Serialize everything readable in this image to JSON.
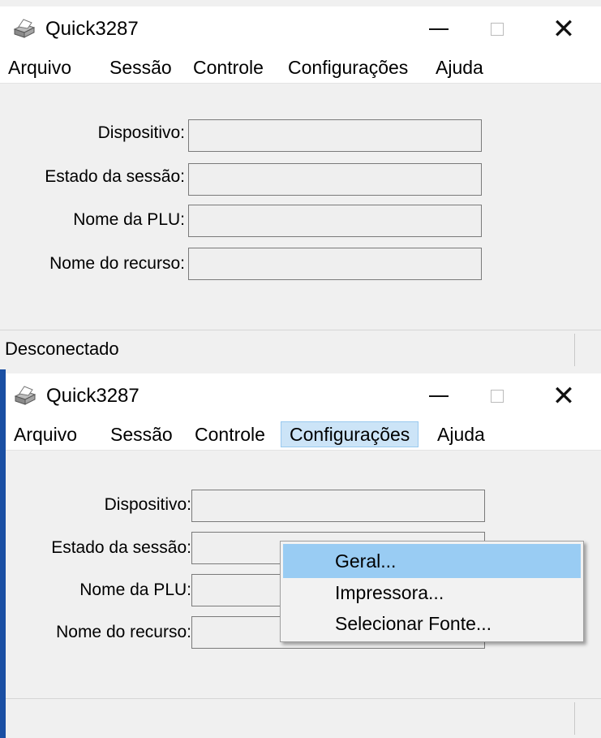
{
  "window1": {
    "title": "Quick3287",
    "menu": [
      "Arquivo",
      "Sessão",
      "Controle",
      "Configurações",
      "Ajuda"
    ],
    "fields": [
      {
        "label": "Dispositivo:",
        "value": ""
      },
      {
        "label": "Estado da sessão:",
        "value": ""
      },
      {
        "label": "Nome da PLU:",
        "value": ""
      },
      {
        "label": "Nome do recurso:",
        "value": ""
      }
    ],
    "status": "Desconectado"
  },
  "window2": {
    "title": "Quick3287",
    "menu": [
      "Arquivo",
      "Sessão",
      "Controle",
      "Configurações",
      "Ajuda"
    ],
    "active_menu": "Configurações",
    "fields": [
      {
        "label": "Dispositivo:",
        "value": ""
      },
      {
        "label": "Estado da sessão:",
        "value": ""
      },
      {
        "label": "Nome da PLU:",
        "value": ""
      },
      {
        "label": "Nome do recurso:",
        "value": ""
      }
    ],
    "status": ""
  },
  "dropdown": {
    "items": [
      "Geral...",
      "Impressora...",
      "Selecionar Fonte..."
    ],
    "highlighted": "Geral..."
  },
  "title_buttons": {
    "minimize": "minimize-icon",
    "maximize": "maximize-icon",
    "close": "close-icon",
    "close_glyph": "✕"
  },
  "colors": {
    "accent": "#2b579a",
    "menu_active_bg": "#cce4f7",
    "menu_highlight": "#99ccf3",
    "window_bg": "#f0f0f0"
  }
}
